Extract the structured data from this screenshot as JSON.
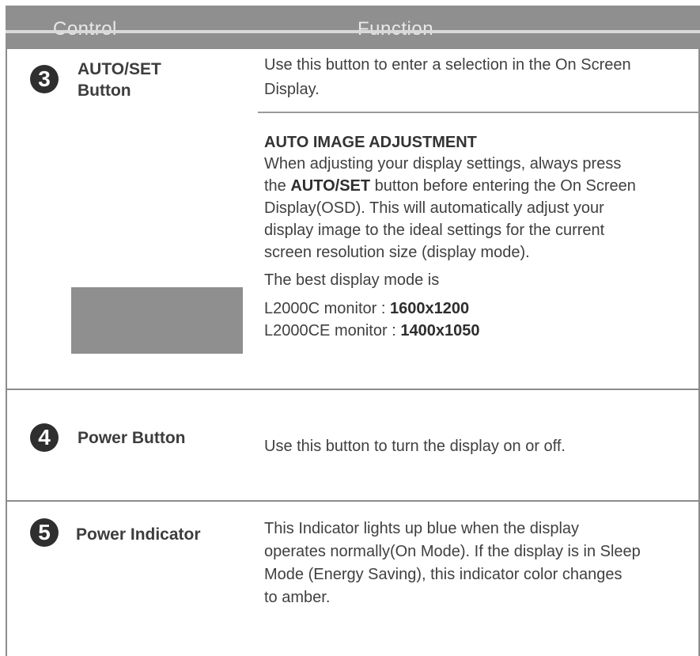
{
  "header": {
    "control": "Control",
    "function": "Function"
  },
  "rows": [
    {
      "number": "3",
      "label_line1": "AUTO/SET",
      "label_line2": "Button",
      "desc_line1": "Use this button to enter a selection in the On Screen",
      "desc_line2": "Display.",
      "sub_title": "AUTO IMAGE ADJUSTMENT",
      "para_line1": "When adjusting your display settings, always press",
      "para_line2_pre": "the ",
      "para_line2_bold": "AUTO/SET",
      "para_line2_post": " button before entering the On Screen",
      "para_line3": "Display(OSD). This will automatically adjust your",
      "para_line4": "display image to the ideal settings for the current",
      "para_line5": "screen resolution size (display mode).",
      "best_mode": "The best display mode is",
      "mode1_label": "L2000C monitor : ",
      "mode1_value": "1600x1200",
      "mode2_label": "L2000CE monitor : ",
      "mode2_value": "1400x1050"
    },
    {
      "number": "4",
      "label": "Power Button",
      "desc": "Use this button to turn the display on or off."
    },
    {
      "number": "5",
      "label": "Power Indicator",
      "desc_line1": "This Indicator lights up blue when the display",
      "desc_line2": "operates normally(On Mode). If the display is in Sleep",
      "desc_line3": "Mode (Energy Saving), this indicator color changes",
      "desc_line4": "to amber."
    }
  ]
}
